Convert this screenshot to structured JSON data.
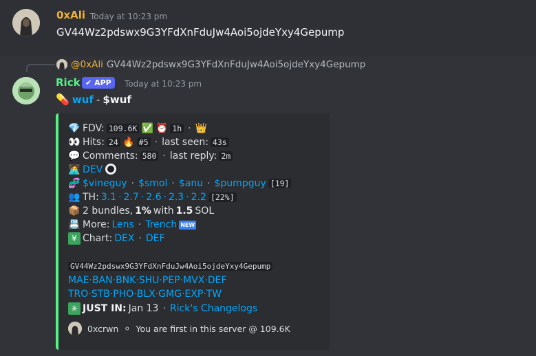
{
  "message1": {
    "username": "0xAli",
    "timestamp": "Today at 10:23 pm",
    "text": "GV44Wz2pdswx9G3YFdXnFduJw4Aoi5ojdeYxy4Gepump"
  },
  "reply": {
    "username": "@0xAli",
    "text": "GV44Wz2pdswx9G3YFdXnFduJw4Aoi5ojdeYxy4Gepump"
  },
  "message2": {
    "username": "Rick",
    "badge": "APP",
    "timestamp": "Today at 10:23 pm",
    "title_name": "wuf",
    "title_sep": "-",
    "title_ticker": "$wuf"
  },
  "embed": {
    "fdv_label": "FDV:",
    "fdv_value": "109.6K",
    "age_value": "1h",
    "hits_label": "Hits:",
    "hits_value": "24",
    "hits_rank": "#5",
    "last_seen_label": "last seen:",
    "last_seen_value": "43s",
    "comments_label": "Comments:",
    "comments_value": "580",
    "last_reply_label": "last reply:",
    "last_reply_value": "2m",
    "dev_link": "DEV",
    "callers": [
      "$vineguy",
      "$smol",
      "$anu",
      "$pumpguy"
    ],
    "callers_count": "[19]",
    "th_label": "TH:",
    "th_values": [
      "3.1",
      "2.7",
      "2.6",
      "2.3",
      "2.2"
    ],
    "th_total": "[22%]",
    "bundles_text": "2 bundles,",
    "bundles_pct": "1%",
    "bundles_with": "with",
    "bundles_sol": "1.5",
    "bundles_unit": "SOL",
    "more_label": "More:",
    "more_links": [
      "Lens",
      "Trench"
    ],
    "new_badge": "NEW",
    "chart_label": "Chart:",
    "chart_links": [
      "DEX",
      "DEF"
    ],
    "contract": "GV44Wz2pdswx9G3YFdXnFduJw4Aoi5ojdeYxy4Gepump",
    "row1_links": [
      "MAE",
      "BAN",
      "BNK",
      "SHU",
      "PEP",
      "MVX",
      "DEF"
    ],
    "row2_links": [
      "TRO",
      "STB",
      "PHO",
      "BLX",
      "GMG",
      "EXP",
      "TW"
    ],
    "just_in_label": "JUST IN:",
    "just_in_date": "Jan 13",
    "changelog_link": "Rick's Changelogs",
    "footer_user": "0xcrwn",
    "footer_text": "You are first in this server @ 109.6K"
  },
  "colors": {
    "ali_name": "#f0b232",
    "rick_name": "#57f287",
    "link": "#00a8fc",
    "embed_accent": "#57f287",
    "badge": "#5865f2"
  },
  "icons": [
    "gem-icon",
    "check-icon",
    "alarm-clock-icon",
    "crown-icon",
    "eyes-icon",
    "fire-icon",
    "speech-bubble-icon",
    "technologist-icon",
    "logo-icon",
    "dna-icon",
    "people-icon",
    "package-icon",
    "card-index-icon",
    "chart-yen-icon",
    "sparkle-icon",
    "pill-icon"
  ]
}
